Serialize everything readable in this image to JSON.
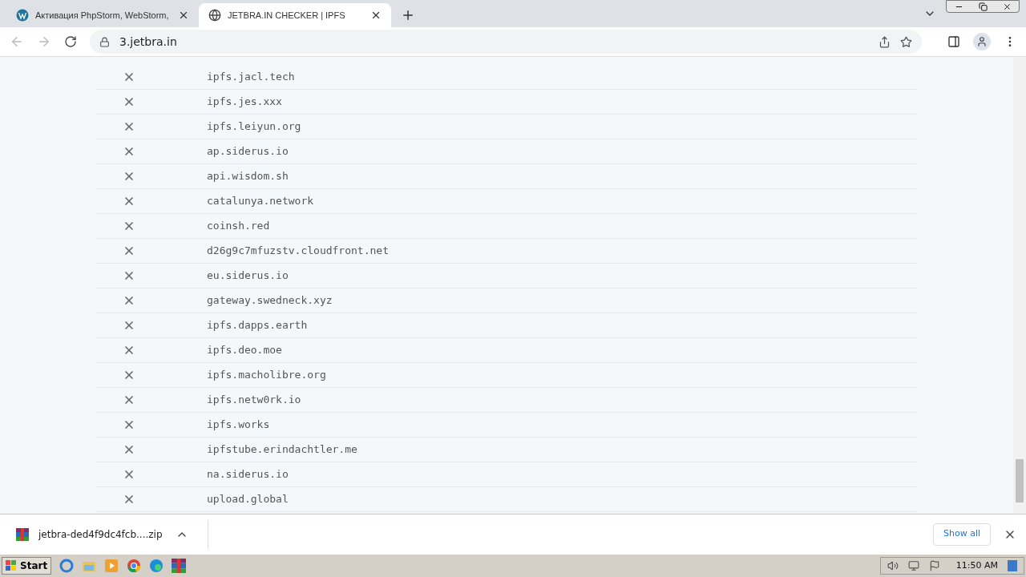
{
  "tabs": [
    {
      "title": "Активация PhpStorm, WebStorm,",
      "kind": "wordpress",
      "selected": false
    },
    {
      "title": "JETBRA.IN CHECKER | IPFS",
      "kind": "globe",
      "selected": true
    }
  ],
  "address": "3.jetbra.in",
  "hosts": [
    "ipfs.jacl.tech",
    "ipfs.jes.xxx",
    "ipfs.leiyun.org",
    "ap.siderus.io",
    "api.wisdom.sh",
    "catalunya.network",
    "coinsh.red",
    "d26g9c7mfuzstv.cloudfront.net",
    "eu.siderus.io",
    "gateway.swedneck.xyz",
    "ipfs.dapps.earth",
    "ipfs.deo.moe",
    "ipfs.macholibre.org",
    "ipfs.netw0rk.io",
    "ipfs.works",
    "ipfstube.erindachtler.me",
    "na.siderus.io",
    "upload.global"
  ],
  "download": {
    "file": "jetbra-ded4f9dc4fcb....zip",
    "show_all": "Show all"
  },
  "taskbar": {
    "start": "Start",
    "time": "11:50 AM"
  }
}
